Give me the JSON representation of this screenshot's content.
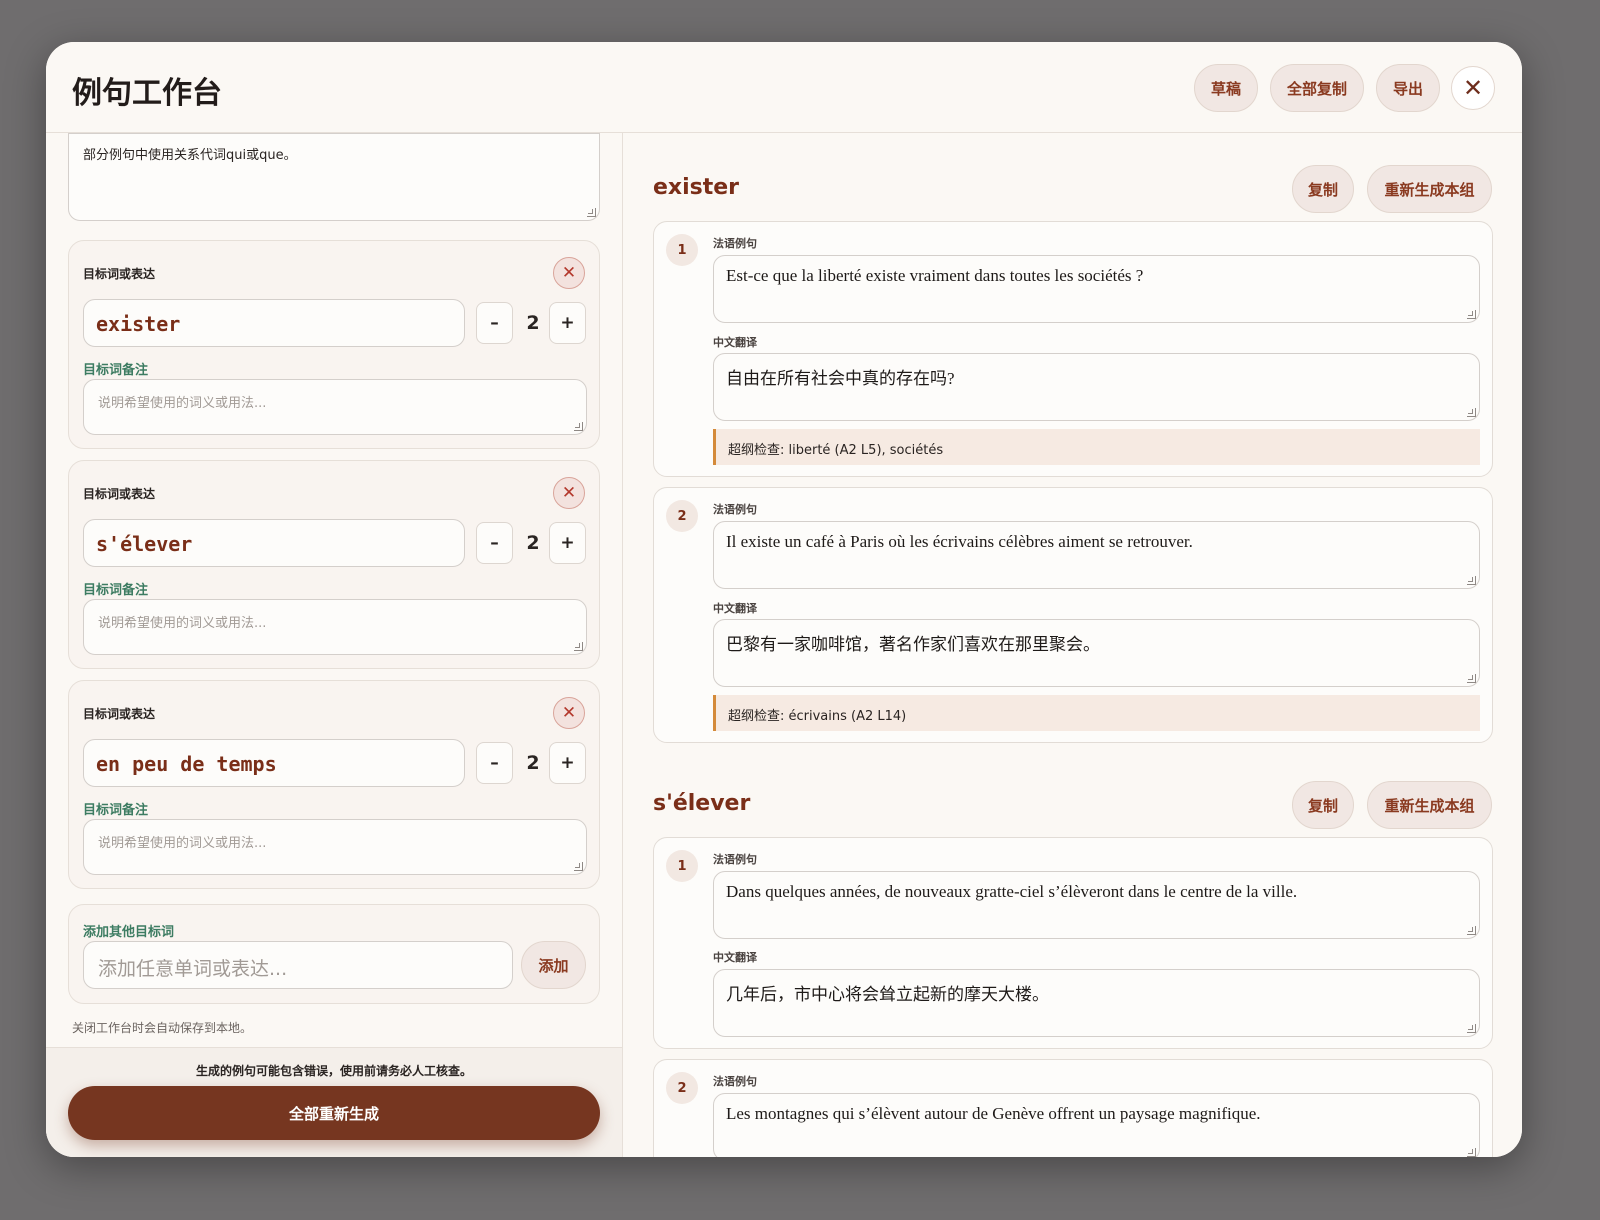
{
  "header": {
    "title": "例句工作台",
    "draft_label": "草稿",
    "copy_all_label": "全部复制",
    "export_label": "导出",
    "close_glyph": "✕"
  },
  "left": {
    "general_note": "部分例句中使用关系代词qui或que。",
    "target_label": "目标词或表达",
    "note_label": "目标词备注",
    "note_placeholder": "说明希望使用的词义或用法...",
    "remove_glyph": "✕",
    "minus_glyph": "–",
    "plus_glyph": "+",
    "targets": [
      {
        "word": "exister",
        "count": "2"
      },
      {
        "word": "s'élever",
        "count": "2"
      },
      {
        "word": "en peu de temps",
        "count": "2"
      }
    ],
    "add": {
      "label": "添加其他目标词",
      "placeholder": "添加任意单词或表达...",
      "button": "添加"
    },
    "autosave_note": "关闭工作台时会自动保存到本地。",
    "footer_warning": "生成的例句可能包含错误，使用前请务必人工核查。",
    "regenerate_all": "全部重新生成"
  },
  "right": {
    "copy_label": "复制",
    "regen_group_label": "重新生成本组",
    "fr_label": "法语例句",
    "zh_label": "中文翻译",
    "groups": [
      {
        "word": "exister",
        "sentences": [
          {
            "num": "1",
            "fr": "Est-ce que la liberté existe vraiment dans toutes les sociétés ?",
            "zh": "自由在所有社会中真的存在吗?",
            "check": "超纲检查: liberté (A2 L5), sociétés"
          },
          {
            "num": "2",
            "fr": "Il existe un café à Paris où les écrivains célèbres aiment se retrouver.",
            "zh": "巴黎有一家咖啡馆，著名作家们喜欢在那里聚会。",
            "check": "超纲检查: écrivains (A2 L14)"
          }
        ]
      },
      {
        "word": "s'élever",
        "sentences": [
          {
            "num": "1",
            "fr": "Dans quelques années, de nouveaux gratte-ciel s’élèveront dans le centre de la ville.",
            "zh": "几年后，市中心将会耸立起新的摩天大楼。"
          },
          {
            "num": "2",
            "fr": "Les montagnes qui s’élèvent autour de Genève offrent un paysage magnifique."
          }
        ]
      }
    ]
  },
  "colors": {
    "accent": "#763620",
    "word_color": "#7a2e18",
    "note_label_green": "#3d7c62",
    "check_border": "#d48a3a"
  }
}
